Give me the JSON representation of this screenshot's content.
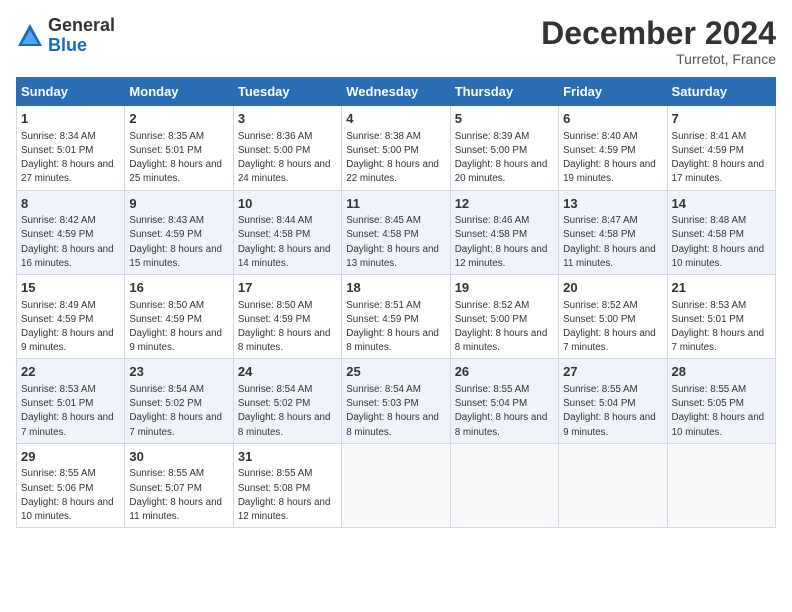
{
  "logo": {
    "general": "General",
    "blue": "Blue"
  },
  "title": "December 2024",
  "location": "Turretot, France",
  "headers": [
    "Sunday",
    "Monday",
    "Tuesday",
    "Wednesday",
    "Thursday",
    "Friday",
    "Saturday"
  ],
  "weeks": [
    [
      {
        "day": "1",
        "sunrise": "Sunrise: 8:34 AM",
        "sunset": "Sunset: 5:01 PM",
        "daylight": "Daylight: 8 hours and 27 minutes."
      },
      {
        "day": "2",
        "sunrise": "Sunrise: 8:35 AM",
        "sunset": "Sunset: 5:01 PM",
        "daylight": "Daylight: 8 hours and 25 minutes."
      },
      {
        "day": "3",
        "sunrise": "Sunrise: 8:36 AM",
        "sunset": "Sunset: 5:00 PM",
        "daylight": "Daylight: 8 hours and 24 minutes."
      },
      {
        "day": "4",
        "sunrise": "Sunrise: 8:38 AM",
        "sunset": "Sunset: 5:00 PM",
        "daylight": "Daylight: 8 hours and 22 minutes."
      },
      {
        "day": "5",
        "sunrise": "Sunrise: 8:39 AM",
        "sunset": "Sunset: 5:00 PM",
        "daylight": "Daylight: 8 hours and 20 minutes."
      },
      {
        "day": "6",
        "sunrise": "Sunrise: 8:40 AM",
        "sunset": "Sunset: 4:59 PM",
        "daylight": "Daylight: 8 hours and 19 minutes."
      },
      {
        "day": "7",
        "sunrise": "Sunrise: 8:41 AM",
        "sunset": "Sunset: 4:59 PM",
        "daylight": "Daylight: 8 hours and 17 minutes."
      }
    ],
    [
      {
        "day": "8",
        "sunrise": "Sunrise: 8:42 AM",
        "sunset": "Sunset: 4:59 PM",
        "daylight": "Daylight: 8 hours and 16 minutes."
      },
      {
        "day": "9",
        "sunrise": "Sunrise: 8:43 AM",
        "sunset": "Sunset: 4:59 PM",
        "daylight": "Daylight: 8 hours and 15 minutes."
      },
      {
        "day": "10",
        "sunrise": "Sunrise: 8:44 AM",
        "sunset": "Sunset: 4:58 PM",
        "daylight": "Daylight: 8 hours and 14 minutes."
      },
      {
        "day": "11",
        "sunrise": "Sunrise: 8:45 AM",
        "sunset": "Sunset: 4:58 PM",
        "daylight": "Daylight: 8 hours and 13 minutes."
      },
      {
        "day": "12",
        "sunrise": "Sunrise: 8:46 AM",
        "sunset": "Sunset: 4:58 PM",
        "daylight": "Daylight: 8 hours and 12 minutes."
      },
      {
        "day": "13",
        "sunrise": "Sunrise: 8:47 AM",
        "sunset": "Sunset: 4:58 PM",
        "daylight": "Daylight: 8 hours and 11 minutes."
      },
      {
        "day": "14",
        "sunrise": "Sunrise: 8:48 AM",
        "sunset": "Sunset: 4:58 PM",
        "daylight": "Daylight: 8 hours and 10 minutes."
      }
    ],
    [
      {
        "day": "15",
        "sunrise": "Sunrise: 8:49 AM",
        "sunset": "Sunset: 4:59 PM",
        "daylight": "Daylight: 8 hours and 9 minutes."
      },
      {
        "day": "16",
        "sunrise": "Sunrise: 8:50 AM",
        "sunset": "Sunset: 4:59 PM",
        "daylight": "Daylight: 8 hours and 9 minutes."
      },
      {
        "day": "17",
        "sunrise": "Sunrise: 8:50 AM",
        "sunset": "Sunset: 4:59 PM",
        "daylight": "Daylight: 8 hours and 8 minutes."
      },
      {
        "day": "18",
        "sunrise": "Sunrise: 8:51 AM",
        "sunset": "Sunset: 4:59 PM",
        "daylight": "Daylight: 8 hours and 8 minutes."
      },
      {
        "day": "19",
        "sunrise": "Sunrise: 8:52 AM",
        "sunset": "Sunset: 5:00 PM",
        "daylight": "Daylight: 8 hours and 8 minutes."
      },
      {
        "day": "20",
        "sunrise": "Sunrise: 8:52 AM",
        "sunset": "Sunset: 5:00 PM",
        "daylight": "Daylight: 8 hours and 7 minutes."
      },
      {
        "day": "21",
        "sunrise": "Sunrise: 8:53 AM",
        "sunset": "Sunset: 5:01 PM",
        "daylight": "Daylight: 8 hours and 7 minutes."
      }
    ],
    [
      {
        "day": "22",
        "sunrise": "Sunrise: 8:53 AM",
        "sunset": "Sunset: 5:01 PM",
        "daylight": "Daylight: 8 hours and 7 minutes."
      },
      {
        "day": "23",
        "sunrise": "Sunrise: 8:54 AM",
        "sunset": "Sunset: 5:02 PM",
        "daylight": "Daylight: 8 hours and 7 minutes."
      },
      {
        "day": "24",
        "sunrise": "Sunrise: 8:54 AM",
        "sunset": "Sunset: 5:02 PM",
        "daylight": "Daylight: 8 hours and 8 minutes."
      },
      {
        "day": "25",
        "sunrise": "Sunrise: 8:54 AM",
        "sunset": "Sunset: 5:03 PM",
        "daylight": "Daylight: 8 hours and 8 minutes."
      },
      {
        "day": "26",
        "sunrise": "Sunrise: 8:55 AM",
        "sunset": "Sunset: 5:04 PM",
        "daylight": "Daylight: 8 hours and 8 minutes."
      },
      {
        "day": "27",
        "sunrise": "Sunrise: 8:55 AM",
        "sunset": "Sunset: 5:04 PM",
        "daylight": "Daylight: 8 hours and 9 minutes."
      },
      {
        "day": "28",
        "sunrise": "Sunrise: 8:55 AM",
        "sunset": "Sunset: 5:05 PM",
        "daylight": "Daylight: 8 hours and 10 minutes."
      }
    ],
    [
      {
        "day": "29",
        "sunrise": "Sunrise: 8:55 AM",
        "sunset": "Sunset: 5:06 PM",
        "daylight": "Daylight: 8 hours and 10 minutes."
      },
      {
        "day": "30",
        "sunrise": "Sunrise: 8:55 AM",
        "sunset": "Sunset: 5:07 PM",
        "daylight": "Daylight: 8 hours and 11 minutes."
      },
      {
        "day": "31",
        "sunrise": "Sunrise: 8:55 AM",
        "sunset": "Sunset: 5:08 PM",
        "daylight": "Daylight: 8 hours and 12 minutes."
      },
      null,
      null,
      null,
      null
    ]
  ]
}
